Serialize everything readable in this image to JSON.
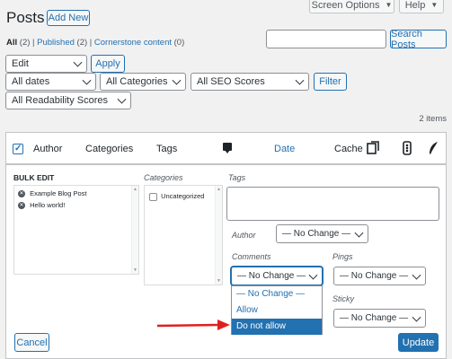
{
  "header": {
    "title": "Posts",
    "add_new": "Add New",
    "screen_options": "Screen Options",
    "help": "Help"
  },
  "filters": {
    "all": "All",
    "all_count": "(2)",
    "published": "Published",
    "published_count": "(2)",
    "cornerstone": "Cornerstone content",
    "cornerstone_count": "(0)",
    "sep": "|",
    "bulk_action": "Edit",
    "apply": "Apply",
    "dates": "All dates",
    "categories": "All Categories",
    "seo": "All SEO Scores",
    "filter": "Filter",
    "readability": "All Readability Scores",
    "search_placeholder": "",
    "search_button": "Search Posts",
    "items_count": "2 items"
  },
  "table": {
    "columns": {
      "author": "Author",
      "categories": "Categories",
      "tags": "Tags",
      "date": "Date",
      "cache": "Cache"
    }
  },
  "bulk_edit": {
    "heading": "BULK EDIT",
    "posts": [
      "Example Blog Post",
      "Hello world!"
    ],
    "categories_label": "Categories",
    "categories": [
      "Uncategorized"
    ],
    "tags_label": "Tags",
    "author_label": "Author",
    "author_value": "— No Change —",
    "comments_label": "Comments",
    "comments_value": "— No Change —",
    "comments_options": [
      "— No Change —",
      "Allow",
      "Do not allow"
    ],
    "pings_label": "Pings",
    "pings_value": "— No Change —",
    "sticky_label": "Sticky",
    "sticky_value": "— No Change —",
    "cancel": "Cancel",
    "update": "Update"
  },
  "colors": {
    "accent": "#2271b1",
    "highlight": "#2271b1",
    "arrow": "#e02020"
  }
}
